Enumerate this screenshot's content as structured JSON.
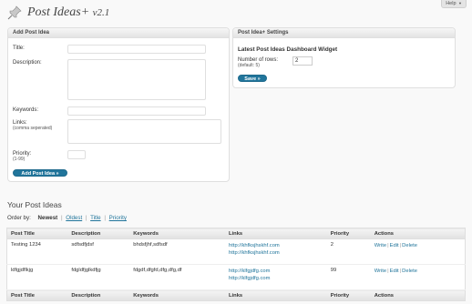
{
  "help_label": "Help",
  "page_title": "Post Ideas+",
  "page_version": "v2.1",
  "add_box": {
    "title": "Add Post Idea",
    "title_label": "Title:",
    "description_label": "Description:",
    "keywords_label": "Keywords:",
    "links_label": "Links:",
    "links_hint": "(comma seperated)",
    "priority_label": "Priority:",
    "priority_hint": "(1-99)",
    "submit_label": "Add Post Idea »"
  },
  "settings_box": {
    "title": "Post Idea+ Settings",
    "widget_title": "Latest Post Ideas Dashboard Widget",
    "rows_label": "Number of rows:",
    "rows_hint": "(default: 5)",
    "rows_value": "2",
    "save_label": "Save »"
  },
  "ideas": {
    "title": "Your Post Ideas",
    "order_by_label": "Order by:",
    "order_current": "Newest",
    "order_options": [
      "Oldest",
      "Title",
      "Priority"
    ],
    "columns": [
      "Post Title",
      "Description",
      "Keywords",
      "Links",
      "Priority",
      "Actions"
    ],
    "rows": [
      {
        "title": "Testing 1234",
        "description": "sdfsdfjdsf",
        "keywords": "bhdsfjhf,sdfsdf",
        "links": [
          "http://khfksjhskhf.com",
          "http://khfksjhskhf.com"
        ],
        "priority": "2",
        "actions": [
          "Write",
          "Edit",
          "Delete"
        ]
      },
      {
        "title": "ldfgjdflkjg",
        "description": "fdgldfjglkdfjg",
        "keywords": "fdgdf,dfgfd,dfg,dfg,df",
        "links": [
          "http://klfgjdfg.com",
          "http://klfgjdfg.com"
        ],
        "priority": "99",
        "actions": [
          "Write",
          "Edit",
          "Delete"
        ]
      }
    ]
  }
}
